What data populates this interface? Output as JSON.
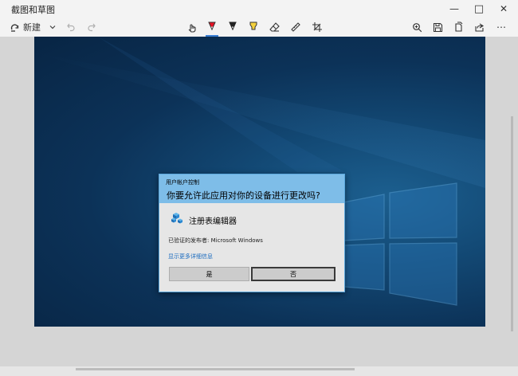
{
  "window": {
    "title": "截图和草图",
    "controls": {
      "minimize": "—",
      "maximize": "□",
      "close": "✕"
    }
  },
  "toolbar": {
    "new_label": "新建",
    "more": "⋯"
  },
  "uac": {
    "caption": "用户帐户控制",
    "question": "你要允许此应用对你的设备进行更改吗?",
    "app_name": "注册表编辑器",
    "publisher": "已验证的发布者: Microsoft Windows",
    "details_link": "显示更多详细信息",
    "yes": "是",
    "no": "否"
  },
  "colors": {
    "uac_header": "#7ebde8",
    "link": "#1a6bbf",
    "desktop": "#0c3258",
    "pen_red": "#e81123",
    "highlighter": "#f4d13d"
  },
  "icons": [
    "new-snip-icon",
    "chevron-down-icon",
    "undo-icon",
    "redo-icon",
    "touch-writing-icon",
    "ballpoint-pen-icon",
    "pencil-icon",
    "highlighter-icon",
    "eraser-icon",
    "ruler-icon",
    "crop-icon",
    "zoom-icon",
    "save-icon",
    "copy-icon",
    "share-icon",
    "more-icon",
    "registry-editor-icon"
  ]
}
